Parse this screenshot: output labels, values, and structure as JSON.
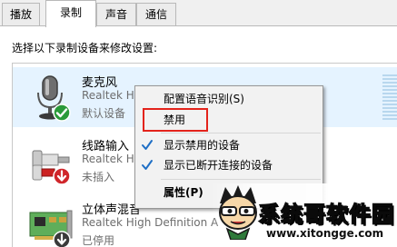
{
  "tabs": [
    {
      "label": "播放",
      "active": false
    },
    {
      "label": "录制",
      "active": true
    },
    {
      "label": "声音",
      "active": false
    },
    {
      "label": "通信",
      "active": false
    }
  ],
  "instruction": "选择以下录制设备来修改设置:",
  "devices": [
    {
      "name": "麦克风",
      "driver": "Realtek H",
      "status": "默认设备",
      "icon": "microphone-icon",
      "badge": "default-check-icon",
      "selected": true
    },
    {
      "name": "线路输入",
      "driver": "Realtek H",
      "status": "未插入",
      "icon": "line-in-jack-icon",
      "badge": "unplugged-arrow-icon",
      "selected": false
    },
    {
      "name": "立体声混音",
      "driver": "Realtek High Definition A",
      "status": "已停用",
      "icon": "sound-card-icon",
      "badge": "disabled-arrow-icon",
      "selected": false
    }
  ],
  "context_menu": {
    "items": [
      {
        "label": "配置语音识别(S)",
        "checked": false
      },
      {
        "label": "禁用",
        "checked": false,
        "highlighted": true
      },
      {
        "label": "显示禁用的设备",
        "checked": true
      },
      {
        "label": "显示已断开连接的设备",
        "checked": true
      },
      {
        "label": "属性(P)",
        "checked": false,
        "bold": true
      }
    ]
  },
  "watermark": {
    "brand": "系统哥软件园",
    "url": "www.xitongge.com"
  },
  "colors": {
    "selected_row": "#e5f3ff",
    "highlight_box": "#e3231b",
    "check_blue": "#1f6fc5",
    "default_green": "#2a9a3a",
    "unplugged_red": "#d0262b"
  }
}
